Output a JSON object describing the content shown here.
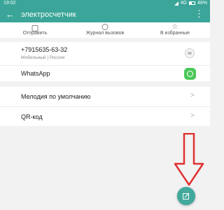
{
  "status_bar": {
    "time": "19:02",
    "network": "4G",
    "battery": "46%"
  },
  "app_bar": {
    "title": "электросчетчик",
    "back_icon": "back-arrow-icon",
    "menu_icon": "more-vert-icon"
  },
  "actions": [
    {
      "label": "Отправить",
      "icon": "share-icon"
    },
    {
      "label": "Журнал вызовов",
      "icon": "clock-icon"
    },
    {
      "label": "В избранные",
      "icon": "star-icon"
    }
  ],
  "contact": {
    "phone": "+7915635-63-32",
    "phone_meta": "Мобильный | Россия",
    "whatsapp": "WhatsApp"
  },
  "settings": [
    {
      "label": "Мелодия по умолчанию"
    },
    {
      "label": "QR-код"
    }
  ],
  "colors": {
    "accent": "#3aa598",
    "arrow": "#e03030",
    "whatsapp": "#4cc85a"
  }
}
